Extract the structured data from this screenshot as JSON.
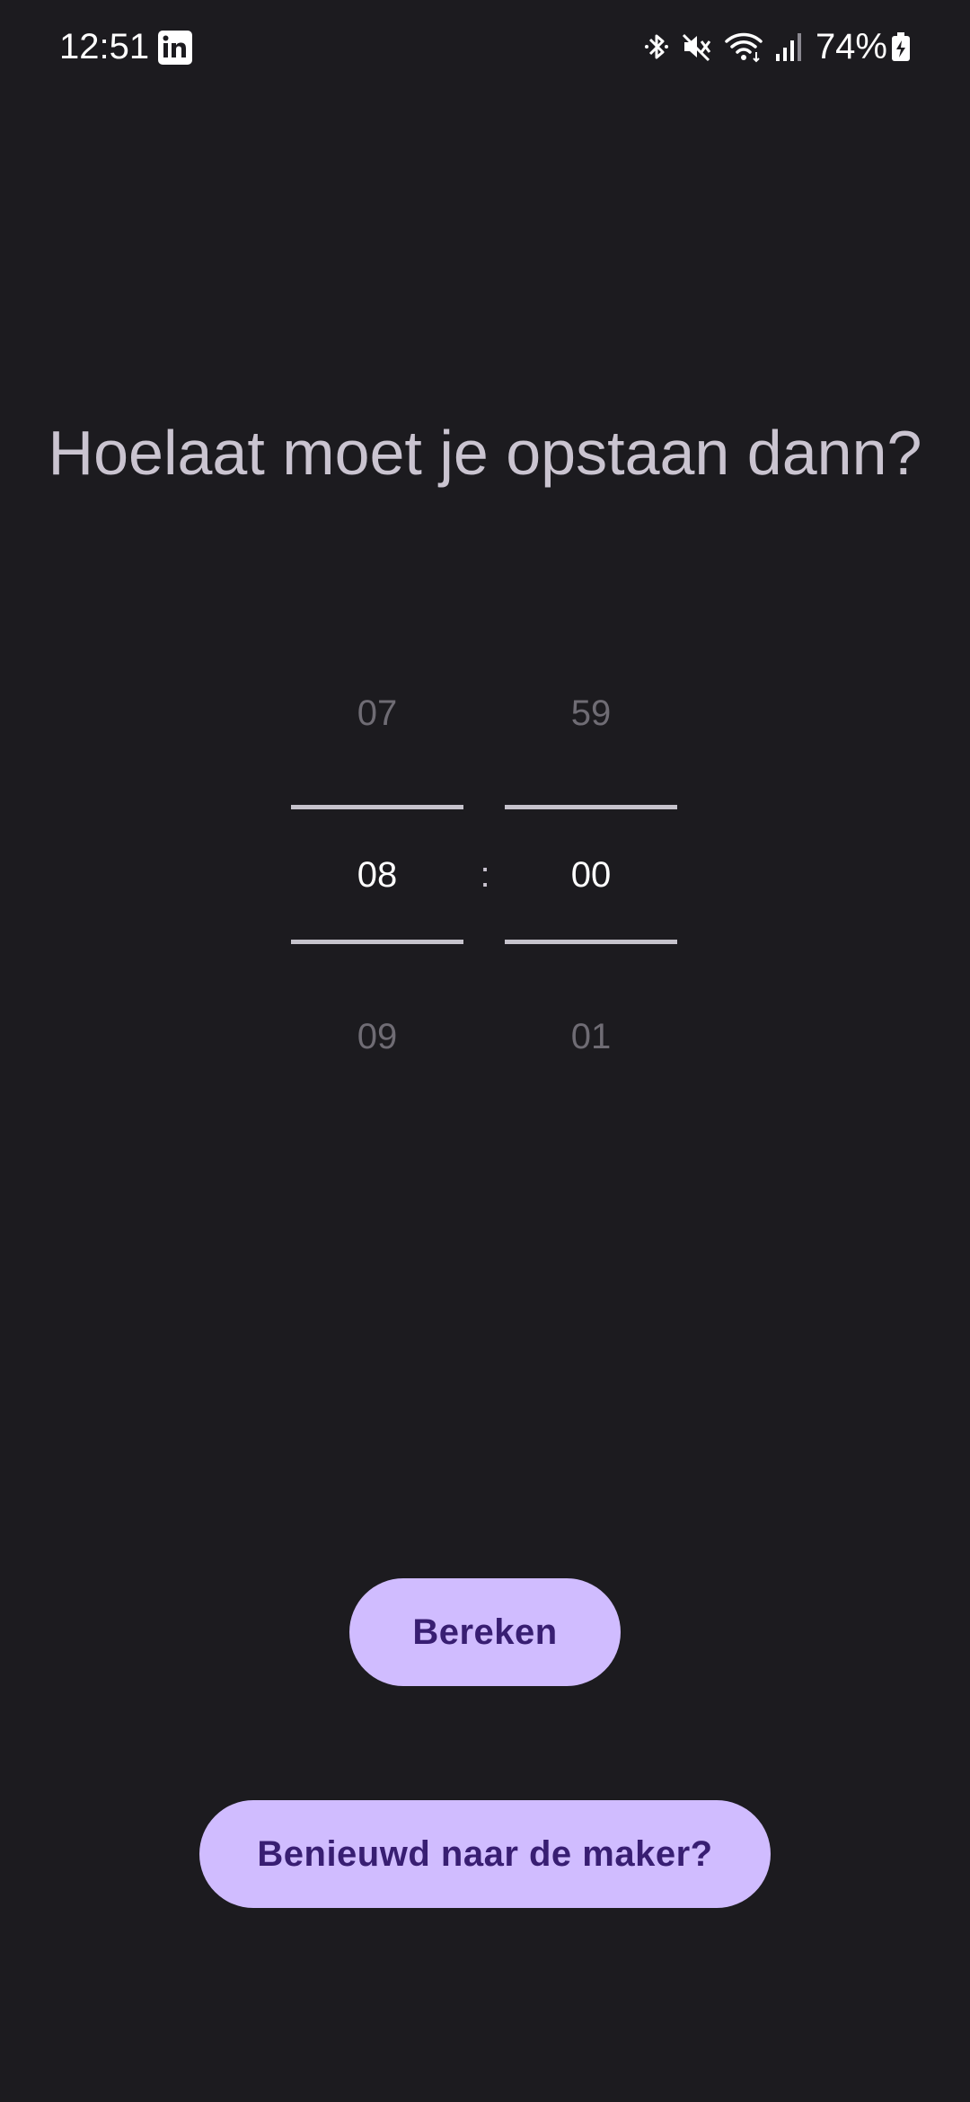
{
  "status_bar": {
    "time": "12:51",
    "notification_icon": "linkedin-icon",
    "icons": [
      "bluetooth-icon",
      "mute-icon",
      "wifi-icon",
      "signal-icon"
    ],
    "battery_percent": "74%",
    "battery_icon": "battery-charging-icon"
  },
  "main": {
    "question": "Hoelaat moet je opstaan dann?",
    "time_picker": {
      "hours": {
        "previous": "07",
        "selected": "08",
        "next": "09"
      },
      "minutes": {
        "previous": "59",
        "selected": "00",
        "next": "01"
      },
      "separator": ":"
    },
    "calculate_button": "Bereken",
    "maker_button": "Benieuwd naar de maker?"
  },
  "colors": {
    "background": "#1c1b1f",
    "button_fill": "#d0bcff",
    "button_text": "#381e72",
    "title_text": "#cac4d0"
  }
}
